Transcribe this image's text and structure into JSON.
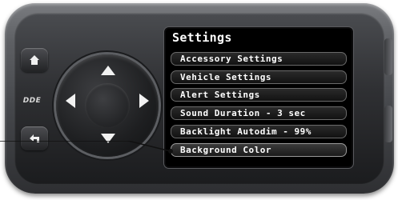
{
  "screen": {
    "title": "Settings",
    "menu_items": [
      {
        "label": "Accessory Settings"
      },
      {
        "label": "Vehicle Settings"
      },
      {
        "label": "Alert Settings"
      },
      {
        "label": "Sound Duration - 3 sec"
      },
      {
        "label": "Backlight Autodim - 99%"
      },
      {
        "label": "Background Color"
      }
    ],
    "selected_index": 5
  },
  "device": {
    "logo_text": "DDE"
  },
  "icons": {
    "home": "home-icon",
    "back": "back-icon",
    "up": "arrow-up-icon",
    "down": "arrow-down-icon",
    "left": "arrow-left-icon",
    "right": "arrow-right-icon"
  },
  "colors": {
    "screen_background": "#000000",
    "text": "#ffffff",
    "item_border": "#6a6a6a",
    "bezel": "#45474b"
  }
}
